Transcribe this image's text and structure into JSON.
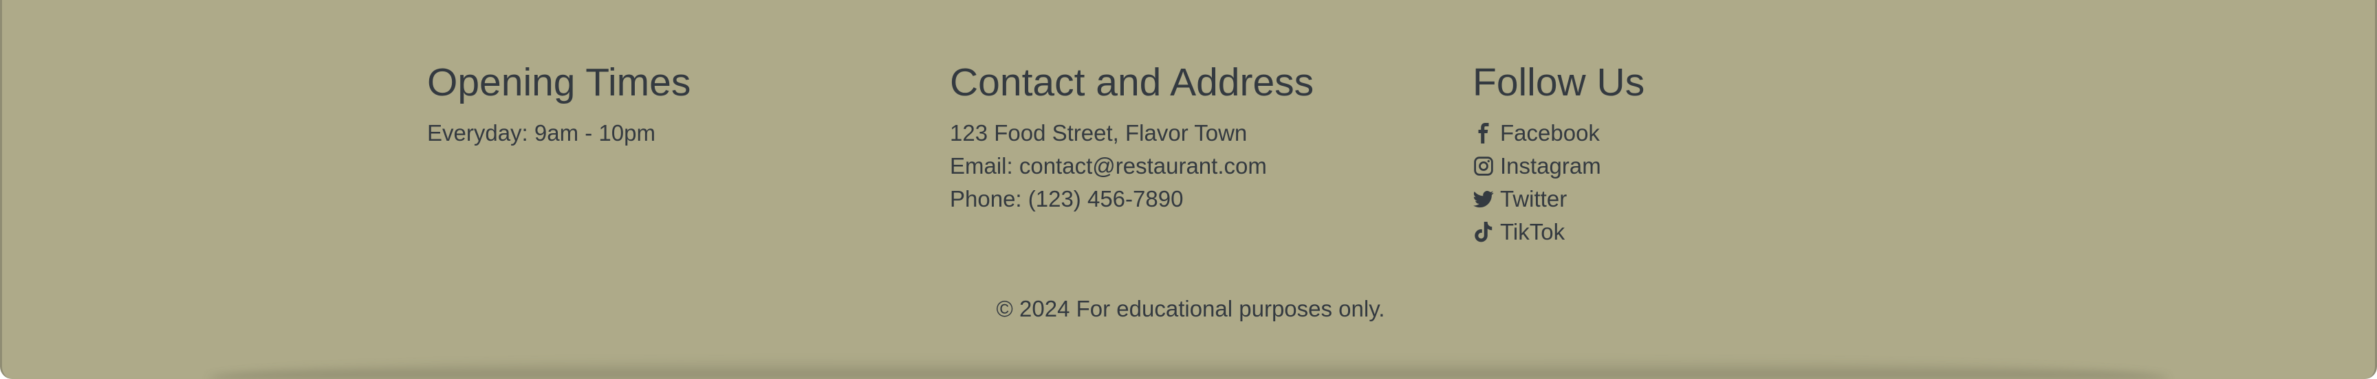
{
  "opening_times": {
    "heading": "Opening Times",
    "hours": "Everyday: 9am - 10pm"
  },
  "contact": {
    "heading": "Contact and Address",
    "address": "123 Food Street, Flavor Town",
    "email": "Email: contact@restaurant.com",
    "phone": "Phone: (123) 456-7890"
  },
  "follow": {
    "heading": "Follow Us",
    "links": [
      {
        "label": "Facebook",
        "icon": "facebook-icon"
      },
      {
        "label": "Instagram",
        "icon": "instagram-icon"
      },
      {
        "label": "Twitter",
        "icon": "twitter-icon"
      },
      {
        "label": "TikTok",
        "icon": "tiktok-icon"
      }
    ]
  },
  "copyright": "© 2024 For educational purposes only.",
  "colors": {
    "footer_background": "#aeaa89",
    "text": "#343a40"
  }
}
